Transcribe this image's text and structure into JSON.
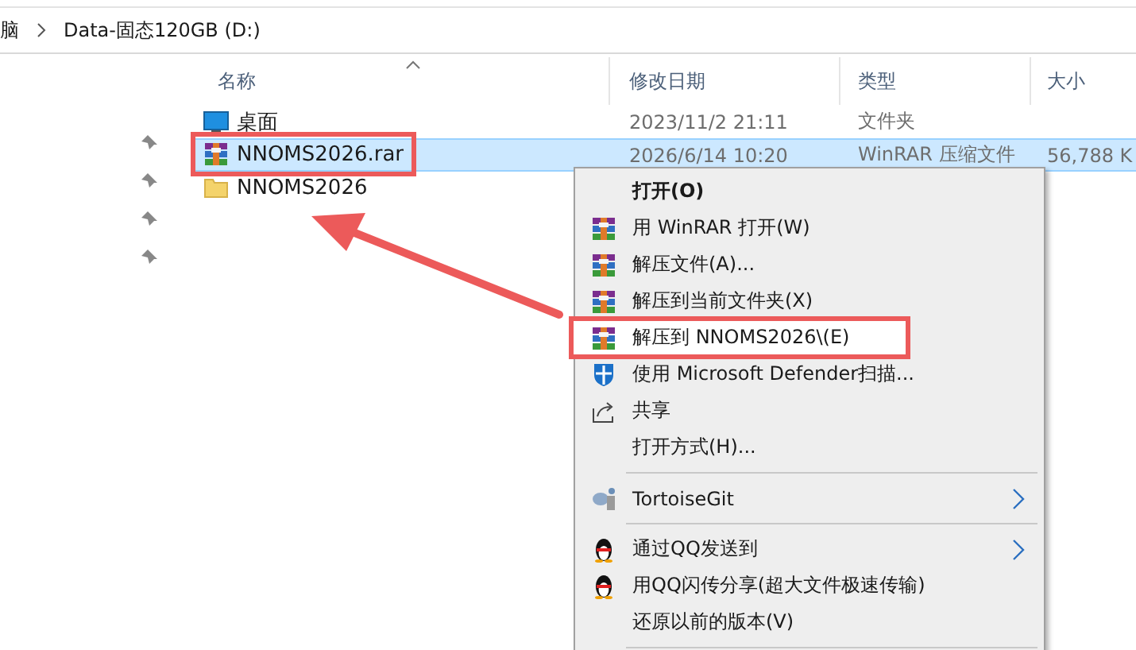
{
  "address_bar": {
    "crumbs": [
      "脑",
      "Data-固态120GB (D:)"
    ]
  },
  "columns": [
    {
      "label": "名称",
      "sorted": true
    },
    {
      "label": "修改日期",
      "sorted": false
    },
    {
      "label": "类型",
      "sorted": false
    },
    {
      "label": "大小",
      "sorted": false
    }
  ],
  "files": [
    {
      "kind": "desktop",
      "name": "桌面",
      "date": "2023/11/2 21:11",
      "type": "文件夹",
      "selected": false,
      "outlined": false
    },
    {
      "kind": "archive",
      "name": "NNOMS2026.rar",
      "date": "2026/6/14 10:20",
      "type": "WinRAR 压缩文件",
      "size": "56,788 K",
      "selected": true,
      "outlined": true
    },
    {
      "kind": "folder",
      "name": "NNOMS2026",
      "selected": false,
      "outlined": false
    }
  ],
  "context_menu": [
    {
      "kind": "plain",
      "label": "打开(O)",
      "bold": true,
      "highlighted": false,
      "outlined": false,
      "submenu": false
    },
    {
      "kind": "archive",
      "label": "用 WinRAR 打开(W)",
      "bold": false,
      "highlighted": false,
      "outlined": false,
      "submenu": false
    },
    {
      "kind": "archive",
      "label": "解压文件(A)...",
      "bold": false,
      "highlighted": false,
      "outlined": false,
      "submenu": false
    },
    {
      "kind": "archive",
      "label": "解压到当前文件夹(X)",
      "bold": false,
      "highlighted": false,
      "outlined": false,
      "submenu": false
    },
    {
      "kind": "archive",
      "label": "解压到 NNOMS2026\\(E)",
      "bold": false,
      "highlighted": true,
      "outlined": true,
      "submenu": false
    },
    {
      "kind": "shield",
      "label": "使用 Microsoft Defender扫描...",
      "bold": false,
      "highlighted": false,
      "outlined": false,
      "submenu": false
    },
    {
      "kind": "share",
      "label": "共享",
      "bold": false,
      "highlighted": false,
      "outlined": false,
      "submenu": false
    },
    {
      "kind": "plain",
      "label": "打开方式(H)...",
      "bold": false,
      "highlighted": false,
      "outlined": false,
      "submenu": false
    },
    {
      "kind": "separator"
    },
    {
      "kind": "tortoise",
      "label": "TortoiseGit",
      "bold": false,
      "highlighted": false,
      "outlined": false,
      "submenu": true
    },
    {
      "kind": "separator"
    },
    {
      "kind": "penguin",
      "label": "通过QQ发送到",
      "bold": false,
      "highlighted": false,
      "outlined": false,
      "submenu": true
    },
    {
      "kind": "penguin",
      "label": "用QQ闪传分享(超大文件极速传输)",
      "bold": false,
      "highlighted": false,
      "outlined": false,
      "submenu": false
    },
    {
      "kind": "plain",
      "label": "还原以前的版本(V)",
      "bold": false,
      "highlighted": false,
      "outlined": false,
      "submenu": false
    },
    {
      "kind": "separator"
    }
  ]
}
